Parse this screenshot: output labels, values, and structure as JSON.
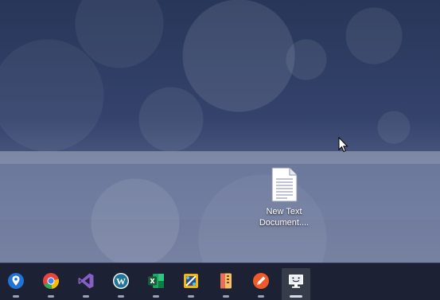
{
  "desktop": {
    "icons": [
      {
        "name": "text-document",
        "label_line1": "New Text",
        "label_line2": "Document...."
      }
    ]
  },
  "taskbar": {
    "apps": [
      {
        "icon": "maps-pin-icon",
        "color": "#1f74d6",
        "running": true
      },
      {
        "icon": "chrome-icon",
        "color": "#e8453c",
        "running": true
      },
      {
        "icon": "visual-studio-icon",
        "color": "#865fc5",
        "running": true
      },
      {
        "icon": "wordpress-icon",
        "color": "#21759b",
        "running": true
      },
      {
        "icon": "excel-icon",
        "color": "#1d7044",
        "running": true
      },
      {
        "icon": "snipping-tool-icon",
        "color": "#f2b705",
        "running": true
      },
      {
        "icon": "archive-icon",
        "color": "#e8a65c",
        "running": true
      },
      {
        "icon": "pen-icon",
        "color": "#f05a28",
        "running": true
      },
      {
        "icon": "remote-desktop-icon",
        "color": "#ffffff",
        "running": true,
        "active": true
      }
    ]
  }
}
